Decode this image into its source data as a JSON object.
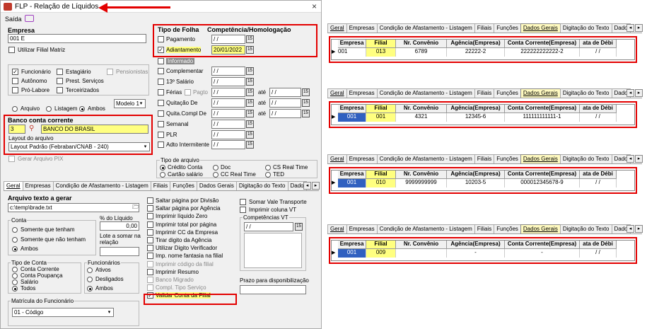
{
  "window": {
    "title": "FLP - Relação de Líquidos",
    "close": "×"
  },
  "menu": {
    "saida": "Saída"
  },
  "left": {
    "empresa_label": "Empresa",
    "empresa_value": "001 E",
    "filial_matriz": "Utilizar Filial Matriz",
    "funcionario": "Funcionário",
    "estagiario": "Estagiário",
    "pensionistas": "Pensionistas",
    "autonomo": "Autônomo",
    "prest_servicos": "Prest. Serviços",
    "pro_labore": "Pró-Labore",
    "terceirizados": "Terceirizados",
    "modelo": "Modelo 1",
    "arquivo": "Arquivo",
    "listagem": "Listagem",
    "ambos": "Ambos",
    "banco_label": "Banco conta corrente",
    "banco_code": "3",
    "banco_name": "BANCO DO BRASIL",
    "layout_label": "Layout do arquivo",
    "layout_value": "Layout Padrão (Febraban/CNAB - 240)",
    "gerar_pix": "Gerar Arquivo PIX"
  },
  "tipo_folha": {
    "header": "Tipo de Folha",
    "header2": "Competência/Homologação",
    "pagamento": "Pagamento",
    "adiantamento": "Adiantamento",
    "adiantamento_date": "20/01/2022",
    "informado": "Informado",
    "complementar": "Complementar",
    "salario13": "13º Salário",
    "ferias": "Férias",
    "pagto": "Pagto",
    "ate": "até",
    "quitacao": "Quitação De",
    "doc": "Doc",
    "quita_compl": "Quita.Compl De",
    "semanal": "Semanal",
    "plr": "PLR",
    "adto_intermitente": "Adto Intermitente",
    "empty_date": " /  /"
  },
  "tipo_arquivo": {
    "label": "Tipo de arquivo",
    "credito_conta": "Crédito Conta",
    "doc": "Doc",
    "cs_real_time": "CS Real Time",
    "cartao_salario": "Cartão salário",
    "cc_real_time": "CC Real Time",
    "ted": "TED"
  },
  "bottom_tabs": [
    "Geral",
    "Empresas",
    "Condição de Afastamento - Listagem",
    "Filiais",
    "Funções",
    "Dados Gerais",
    "Digitação do Texto",
    "Dado"
  ],
  "geral": {
    "arquivo_texto_label": "Arquivo texto a gerar",
    "arquivo_texto_value": "c:\\temp\\brade.txt",
    "pct_liquido": "% do Líquido",
    "pct_value": "0,00",
    "lote_label": "Lote a somar na relação",
    "conta_label": "Conta",
    "somente_tenham": "Somente que tenham",
    "somente_nao": "Somente que não tenham",
    "ambos": "Ambos",
    "tipo_conta_label": "Tipo de Conta",
    "conta_corrente": "Conta Corrente",
    "conta_poupanca": "Conta Poupança",
    "salario": "Salário",
    "todos": "Todos",
    "funcionarios_label": "Funcionários",
    "ativos": "Ativos",
    "desligados": "Desligados",
    "ambos2": "Ambos",
    "matricula_label": "Matrícula do Funcionário",
    "matricula_value": "01 - Código",
    "opts": [
      "Saltar página por Divisão",
      "Saltar página por Agência",
      "Imprimir líquido Zero",
      "Imprimir total por página",
      "Imprimir CC da Empresa",
      "Tirar digito da Agência",
      "Utilizar Digito Verificador",
      "Imp. nome fantasia na filial",
      "Imprimir código da filial",
      "Imprimir Resumo",
      "Banco Migrado",
      "Compl. Tipo Serviço",
      "Validar Conta da Filial"
    ],
    "somar_vale": "Somar Vale Transporte",
    "imprimir_vt": "Imprimir coluna VT",
    "competencias_vt": "Competências VT",
    "prazo": "Prazo para disponibilização"
  },
  "right_tabs": [
    "Geral",
    "Empresas",
    "Condição de Afastamento - Listagem",
    "Filiais",
    "Funções",
    "Dados Gerais",
    "Digitação do Texto",
    "Dado"
  ],
  "grid_headers": [
    "Empresa",
    "Filial",
    "Nr. Convênio",
    "Agência(Empresa)",
    "Conta Corrente(Empresa)",
    "ata de Débi"
  ],
  "grids": [
    {
      "empresa": "001",
      "filial": "013",
      "convenio": "6789",
      "agencia": "22222-2",
      "conta": "222222222222-2",
      "data": " /  /"
    },
    {
      "empresa": "001",
      "filial": "001",
      "convenio": "4321",
      "agencia": "12345-6",
      "conta": "111111111111-1",
      "data": " /  /"
    },
    {
      "empresa": "001",
      "filial": "010",
      "convenio": "9999999999",
      "agencia": "10203-5",
      "conta": "000012345678-9",
      "data": " /  /"
    },
    {
      "empresa": "001",
      "filial": "009",
      "convenio": "",
      "agencia": "-",
      "conta": "-",
      "data": " /  /"
    }
  ]
}
